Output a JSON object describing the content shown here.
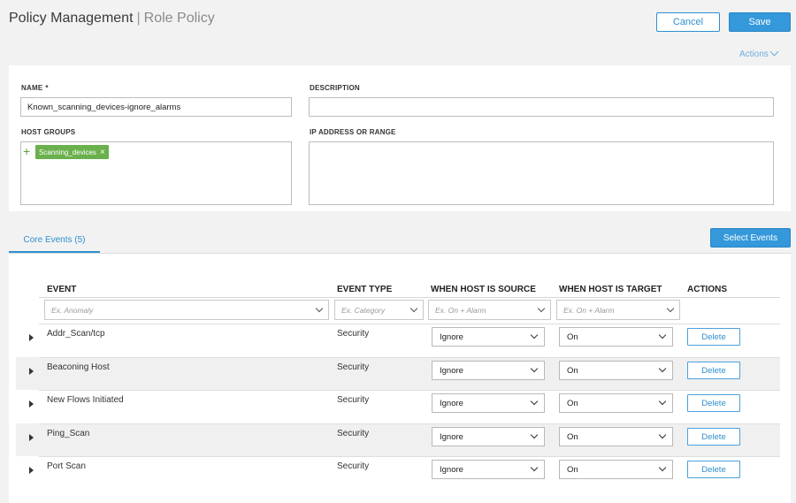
{
  "header": {
    "title": "Policy Management",
    "separator": "|",
    "subtitle": "Role Policy",
    "cancel_label": "Cancel",
    "save_label": "Save",
    "actions_label": "Actions"
  },
  "form": {
    "name_label": "NAME",
    "required_mark": "*",
    "name_value": "Known_scanning_devices-ignore_alarms",
    "description_label": "DESCRIPTION",
    "description_value": "",
    "host_groups_label": "HOST GROUPS",
    "host_group_tag": "Scanning_devices",
    "ip_label": "IP ADDRESS OR RANGE"
  },
  "tabs": {
    "core_events": "Core Events (5)",
    "select_events_label": "Select Events"
  },
  "table": {
    "headers": [
      "EVENT",
      "EVENT TYPE",
      "WHEN HOST IS SOURCE",
      "WHEN HOST IS TARGET",
      "ACTIONS"
    ],
    "filters": {
      "event": "Ex. Anomaly",
      "event_type": "Ex. Category",
      "source": "Ex. On + Alarm",
      "target": "Ex. On + Alarm"
    },
    "delete_label": "Delete",
    "rows": [
      {
        "event": "Addr_Scan/tcp",
        "type": "Security",
        "source": "Ignore",
        "target": "On"
      },
      {
        "event": "Beaconing Host",
        "type": "Security",
        "source": "Ignore",
        "target": "On"
      },
      {
        "event": "New Flows Initiated",
        "type": "Security",
        "source": "Ignore",
        "target": "On"
      },
      {
        "event": "Ping_Scan",
        "type": "Security",
        "source": "Ignore",
        "target": "On"
      },
      {
        "event": "Port Scan",
        "type": "Security",
        "source": "Ignore",
        "target": "On"
      }
    ]
  },
  "colors": {
    "primary": "#3498db",
    "tag_green": "#6ab04c",
    "link_blue": "#2f8fd0"
  }
}
